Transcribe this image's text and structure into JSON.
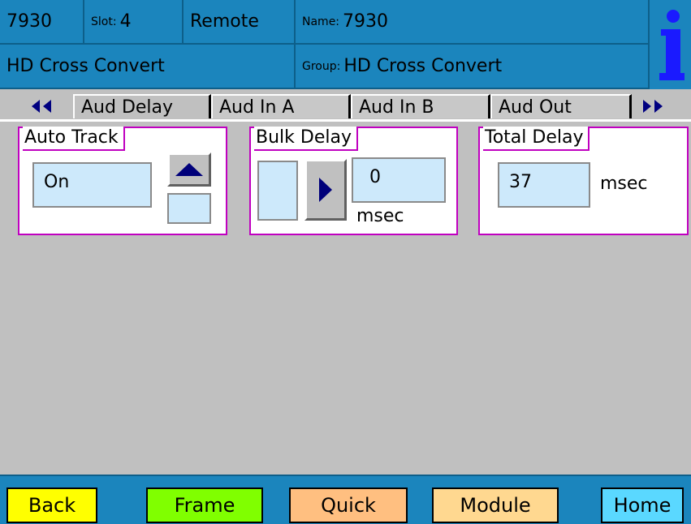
{
  "header": {
    "model": "7930",
    "slot_label": "Slot:",
    "slot_value": "4",
    "mode": "Remote",
    "name_label": "Name:",
    "name_value": "7930",
    "card_type": "HD Cross Convert",
    "group_label": "Group:",
    "group_value": "HD Cross Convert",
    "info_icon": "info-icon"
  },
  "tabs": [
    {
      "label": "Aud Delay",
      "active": true
    },
    {
      "label": "Aud In A",
      "active": false
    },
    {
      "label": "Aud In B",
      "active": false
    },
    {
      "label": "Aud Out",
      "active": false
    }
  ],
  "panels": {
    "auto_track": {
      "title": "Auto Track",
      "value": "On"
    },
    "bulk_delay": {
      "title": "Bulk Delay",
      "value": "0",
      "unit": "msec"
    },
    "total_delay": {
      "title": "Total Delay",
      "value": "37",
      "unit": "msec"
    }
  },
  "footer": {
    "back": "Back",
    "frame": "Frame",
    "quick": "Quick",
    "module": "Module",
    "home": "Home"
  },
  "colors": {
    "header_bg": "#1b85bd",
    "panel_border": "#c000c0",
    "field_bg": "#cde9fb",
    "back": "#ffff00",
    "frame": "#80ff00",
    "quick": "#ffbf80",
    "module": "#ffd890",
    "home": "#5ad8ff"
  }
}
